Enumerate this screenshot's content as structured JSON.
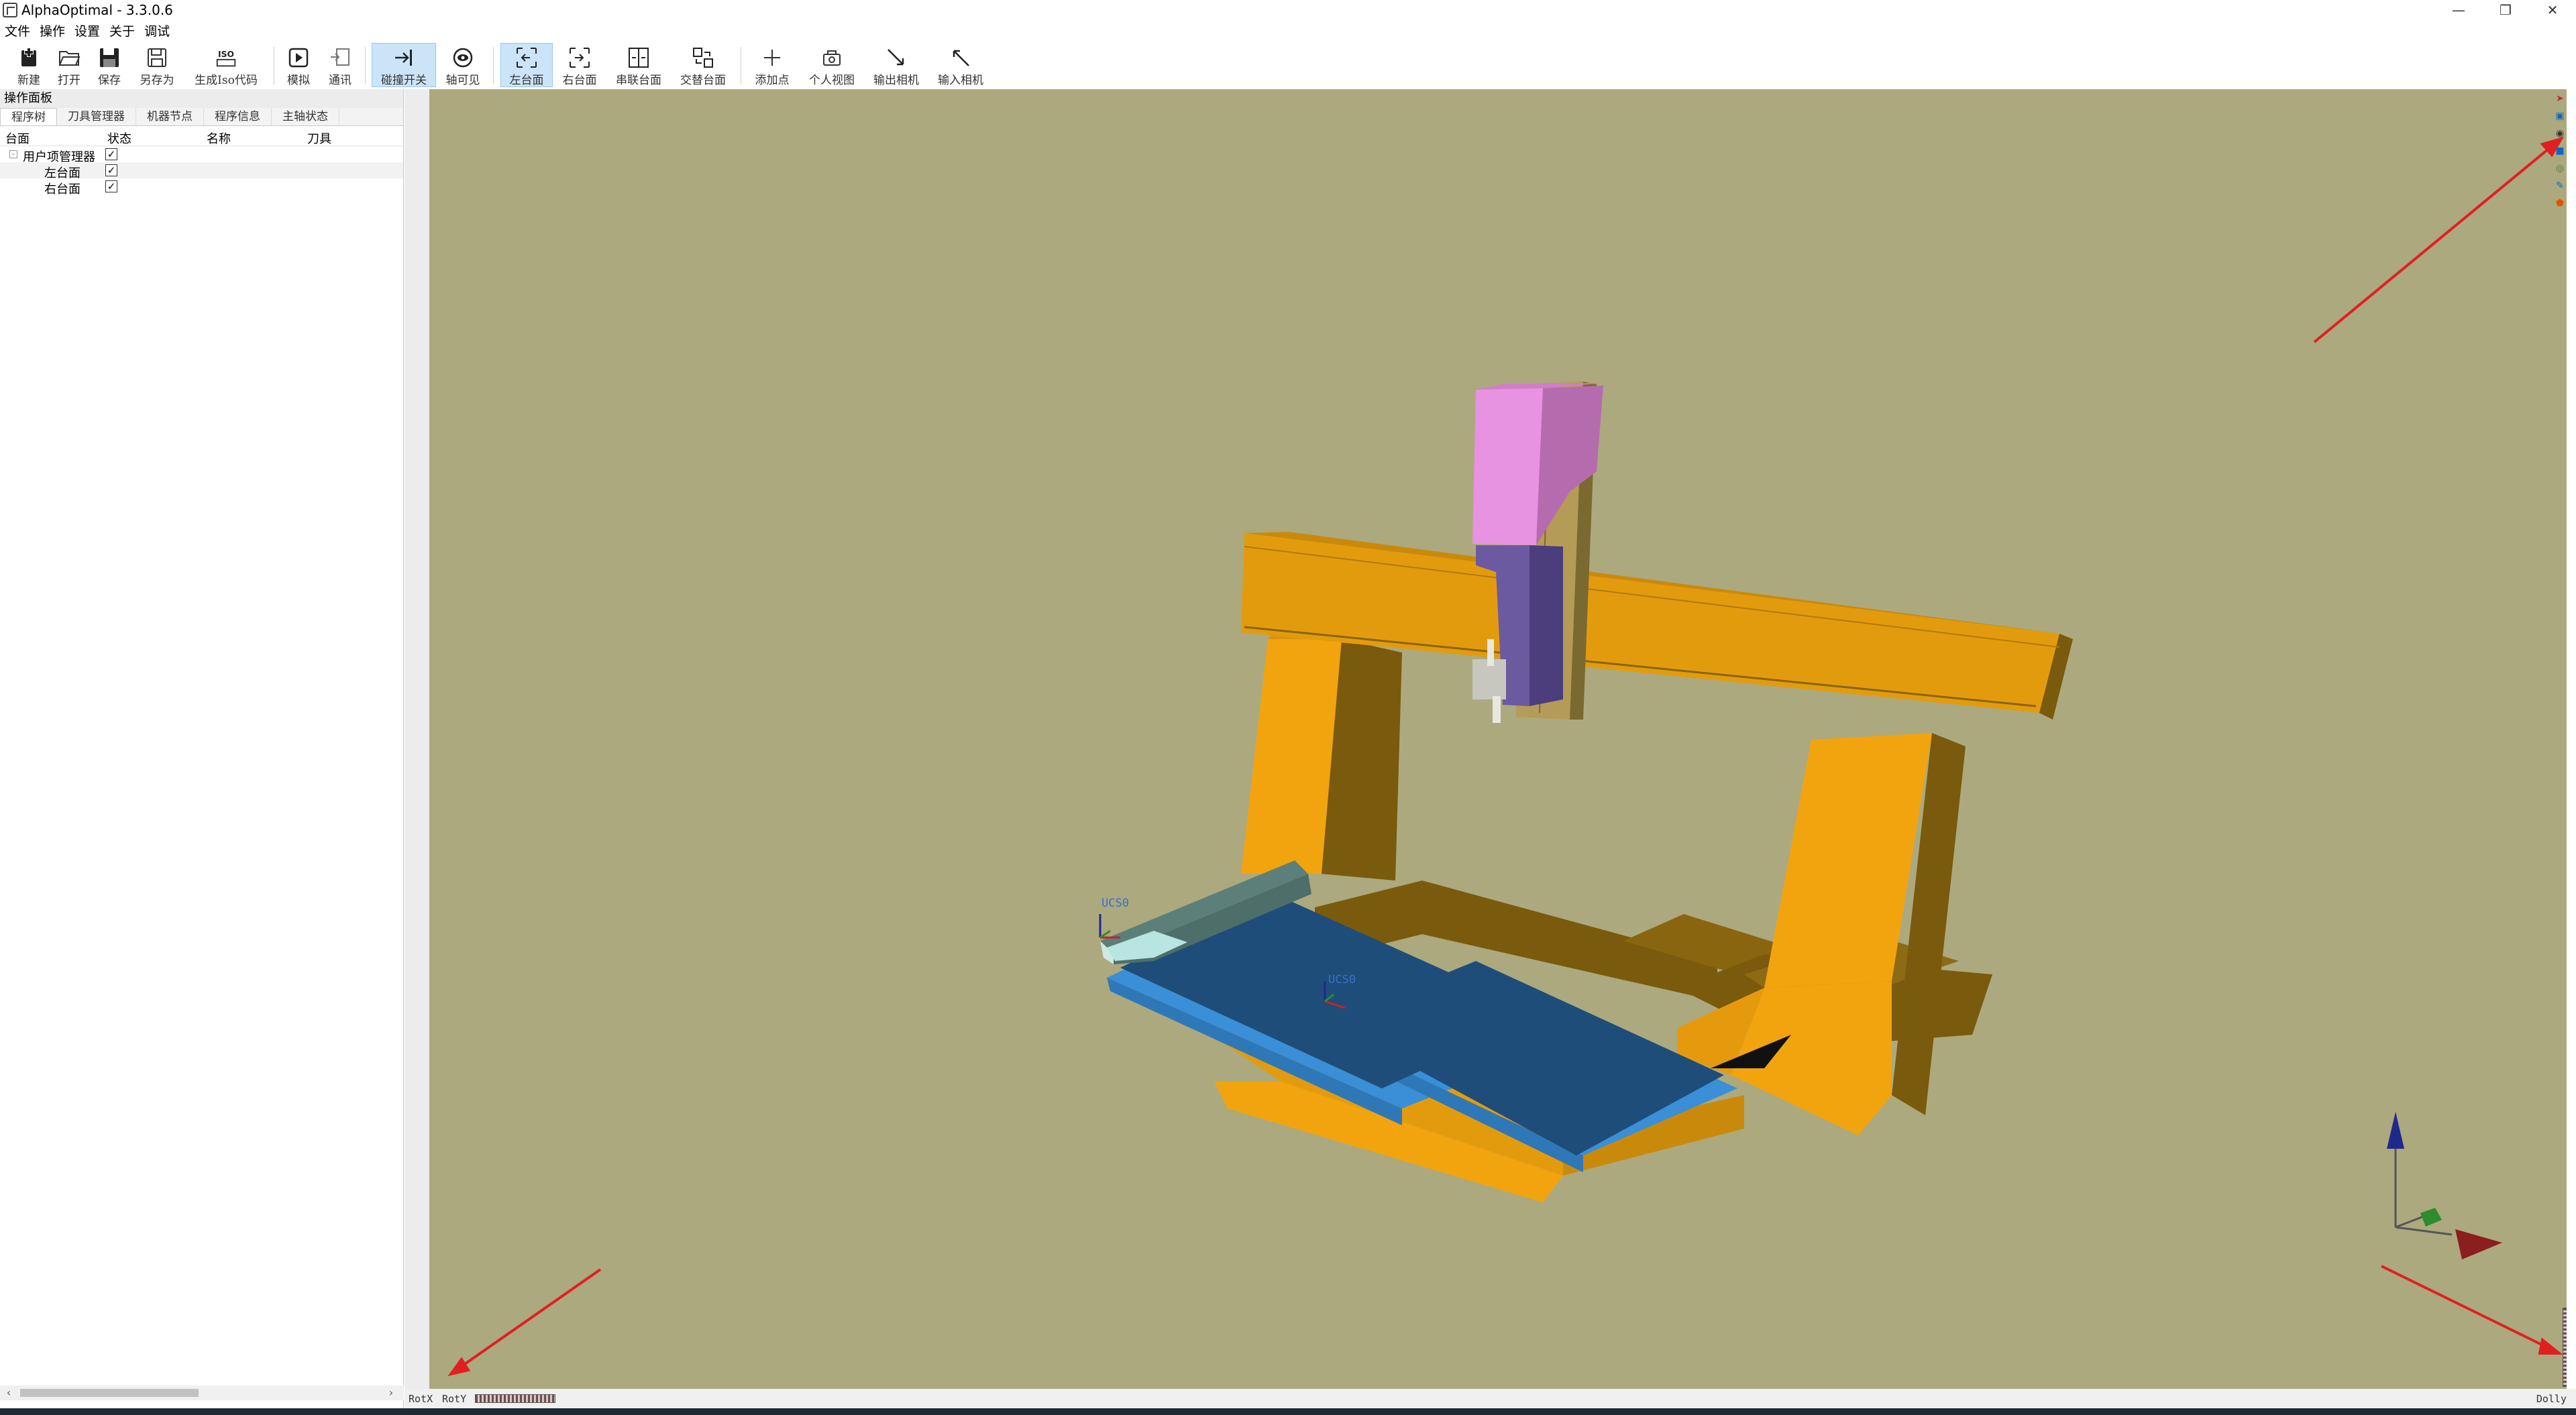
{
  "window": {
    "title": "AlphaOptimal  - 3.3.0.6",
    "controls": [
      "—",
      "❐",
      "✕"
    ]
  },
  "menubar": [
    "文件",
    "操作",
    "设置",
    "关于",
    "调试"
  ],
  "toolbar": {
    "buttons": [
      {
        "label": "新建",
        "icon": "new-file-icon"
      },
      {
        "label": "打开",
        "icon": "open-folder-icon"
      },
      {
        "label": "保存",
        "icon": "save-icon"
      },
      {
        "label": "另存为",
        "icon": "save-as-icon"
      },
      {
        "label": "生成Iso代码",
        "icon": "iso-icon"
      },
      {
        "label": "模拟",
        "icon": "play-icon"
      },
      {
        "label": "通讯",
        "icon": "communication-icon"
      },
      {
        "label": "碰撞开关",
        "icon": "collision-toggle-icon",
        "active": true
      },
      {
        "label": "轴可见",
        "icon": "eye-icon"
      },
      {
        "label": "左台面",
        "icon": "left-table-icon",
        "active": true
      },
      {
        "label": "右台面",
        "icon": "right-table-icon"
      },
      {
        "label": "串联台面",
        "icon": "serial-tables-icon"
      },
      {
        "label": "交替台面",
        "icon": "alternate-tables-icon"
      },
      {
        "label": "添加点",
        "icon": "add-point-icon"
      },
      {
        "label": "个人视图",
        "icon": "personal-view-icon"
      },
      {
        "label": "输出相机",
        "icon": "output-camera-icon"
      },
      {
        "label": "输入相机",
        "icon": "input-camera-icon"
      }
    ]
  },
  "panel": {
    "title": "操作面板",
    "tabs": [
      "程序树",
      "刀具管理器",
      "机器节点",
      "程序信息",
      "主轴状态"
    ],
    "selected_tab": "程序树",
    "columns": [
      "台面",
      "状态",
      "名称",
      "刀具"
    ],
    "tree": [
      {
        "label": "用户项管理器",
        "checked": true,
        "level": 0,
        "expander": "-"
      },
      {
        "label": "左台面",
        "checked": true,
        "level": 1
      },
      {
        "label": "右台面",
        "checked": true,
        "level": 1
      }
    ],
    "check_mark": "✓"
  },
  "viewport": {
    "background": "#aca97e",
    "ucs_labels": [
      "UCS0",
      "UCS0"
    ],
    "right_toolbar_icons": [
      "select-arrow-icon",
      "view-cube-icon",
      "camera-icon",
      "layer-icon",
      "eye-view-icon",
      "pin-icon",
      "shield-icon"
    ]
  },
  "status": {
    "rotx": "RotX",
    "roty": "RotY",
    "dolly": "Dolly"
  },
  "colors": {
    "machine_yellow": "#e39b0e",
    "machine_dark": "#7a5a0c",
    "table_blue": "#1e4d7a",
    "table_light_blue": "#3a8fd6",
    "spindle_pink": "#e892e2",
    "spindle_purple": "#6c5aa0",
    "axis_red": "#8b1e1e",
    "axis_green": "#2e8b2e",
    "axis_blue": "#1d2a8c"
  }
}
